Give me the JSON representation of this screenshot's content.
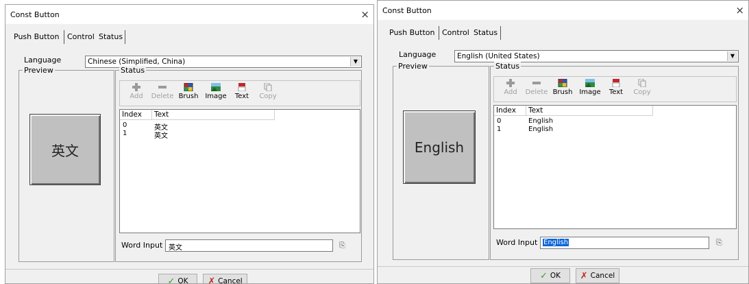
{
  "left": {
    "title": "Const Button",
    "close": "×",
    "tabs": [
      "Push Button",
      "Control",
      "Status"
    ],
    "language_label": "Language",
    "language_value": "Chinese (Simplified, China)",
    "preview_label": "Preview",
    "preview_text": "英文",
    "status_label": "Status",
    "toolbar": [
      {
        "label": "Add",
        "icon": "plus-icon",
        "enabled": false
      },
      {
        "label": "Delete",
        "icon": "minus-icon",
        "enabled": false
      },
      {
        "label": "Brush",
        "icon": "brush-icon",
        "enabled": true
      },
      {
        "label": "Image",
        "icon": "image-icon",
        "enabled": true
      },
      {
        "label": "Text",
        "icon": "text-icon",
        "enabled": true
      },
      {
        "label": "Copy",
        "icon": "copy-icon",
        "enabled": false
      }
    ],
    "columns": [
      "Index",
      "Text"
    ],
    "rows": [
      [
        "0",
        "英文"
      ],
      [
        "1",
        "英文"
      ]
    ],
    "word_input_label": "Word Input",
    "word_input_value": "英文",
    "ok": "OK",
    "cancel": "Cancel"
  },
  "right": {
    "title": "Const Button",
    "close": "×",
    "tabs": [
      "Push Button",
      "Control",
      "Status"
    ],
    "language_label": "Language",
    "language_value": "English (United States)",
    "preview_label": "Preview",
    "preview_text": "English",
    "status_label": "Status",
    "toolbar": [
      {
        "label": "Add",
        "icon": "plus-icon",
        "enabled": false
      },
      {
        "label": "Delete",
        "icon": "minus-icon",
        "enabled": false
      },
      {
        "label": "Brush",
        "icon": "brush-icon",
        "enabled": true
      },
      {
        "label": "Image",
        "icon": "image-icon",
        "enabled": true
      },
      {
        "label": "Text",
        "icon": "text-icon",
        "enabled": true
      },
      {
        "label": "Copy",
        "icon": "copy-icon",
        "enabled": false
      }
    ],
    "columns": [
      "Index",
      "Text"
    ],
    "rows": [
      [
        "0",
        "English"
      ],
      [
        "1",
        "English"
      ]
    ],
    "word_input_label": "Word Input",
    "word_input_value": "English",
    "ok": "OK",
    "cancel": "Cancel"
  }
}
